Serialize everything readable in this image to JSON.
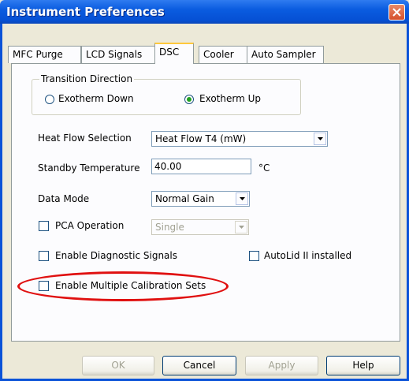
{
  "window": {
    "title": "Instrument Preferences"
  },
  "tabs": [
    {
      "label": "MFC Purge"
    },
    {
      "label": "LCD Signals"
    },
    {
      "label": "DSC"
    },
    {
      "label": "Cooler"
    },
    {
      "label": "Auto Sampler"
    }
  ],
  "transition": {
    "legend": "Transition Direction",
    "option_down": "Exotherm Down",
    "option_up": "Exotherm Up",
    "selected": "Exotherm Up"
  },
  "heat_flow": {
    "label": "Heat Flow Selection",
    "value": "Heat Flow T4 (mW)"
  },
  "standby": {
    "label": "Standby Temperature",
    "value": "40.00",
    "unit": "°C"
  },
  "data_mode": {
    "label": "Data Mode",
    "value": "Normal Gain"
  },
  "pca": {
    "label": "PCA Operation",
    "value": "Single"
  },
  "diagnostic": {
    "label": "Enable Diagnostic Signals"
  },
  "autolid": {
    "label": "AutoLid II installed"
  },
  "calibration": {
    "label": "Enable Multiple Calibration Sets"
  },
  "buttons": {
    "ok": "OK",
    "cancel": "Cancel",
    "apply": "Apply",
    "help": "Help"
  },
  "colors": {
    "titlebar": "#0a5ce0",
    "highlight": "#e01010",
    "radio_dot": "#21a121"
  }
}
